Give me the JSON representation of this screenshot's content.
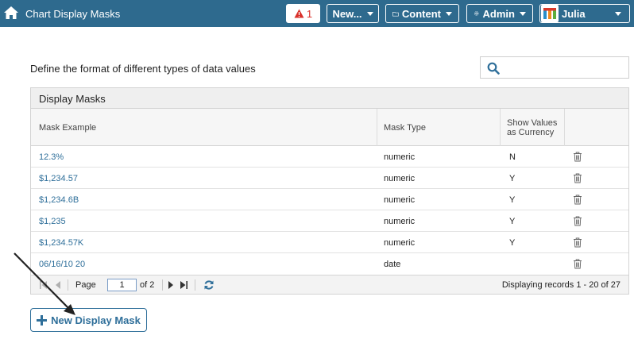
{
  "topbar": {
    "title": "Chart Display Masks",
    "alert_count": "1",
    "new_label": "New...",
    "content_label": "Content",
    "admin_label": "Admin",
    "user_name": "Julia"
  },
  "page": {
    "description": "Define the format of different types of data values",
    "search_placeholder": ""
  },
  "grid": {
    "title": "Display Masks",
    "columns": [
      "Mask Example",
      "Mask Type",
      "Show Values as Currency"
    ],
    "rows": [
      {
        "example": "12.3%",
        "type": "numeric",
        "currency": "N"
      },
      {
        "example": "$1,234.57",
        "type": "numeric",
        "currency": "Y"
      },
      {
        "example": "$1,234.6B",
        "type": "numeric",
        "currency": "Y"
      },
      {
        "example": "$1,235",
        "type": "numeric",
        "currency": "Y"
      },
      {
        "example": "$1,234.57K",
        "type": "numeric",
        "currency": "Y"
      },
      {
        "example": "06/16/10 20",
        "type": "date",
        "currency": ""
      }
    ]
  },
  "pager": {
    "page_label": "Page",
    "current_page": "1",
    "of_label": "of 2",
    "records_text": "Displaying records 1 - 20 of 27"
  },
  "actions": {
    "new_mask_label": "New Display Mask"
  },
  "colors": {
    "topbar": "#2e6a8e",
    "link": "#2f6f9a",
    "alert": "#d9312b"
  }
}
